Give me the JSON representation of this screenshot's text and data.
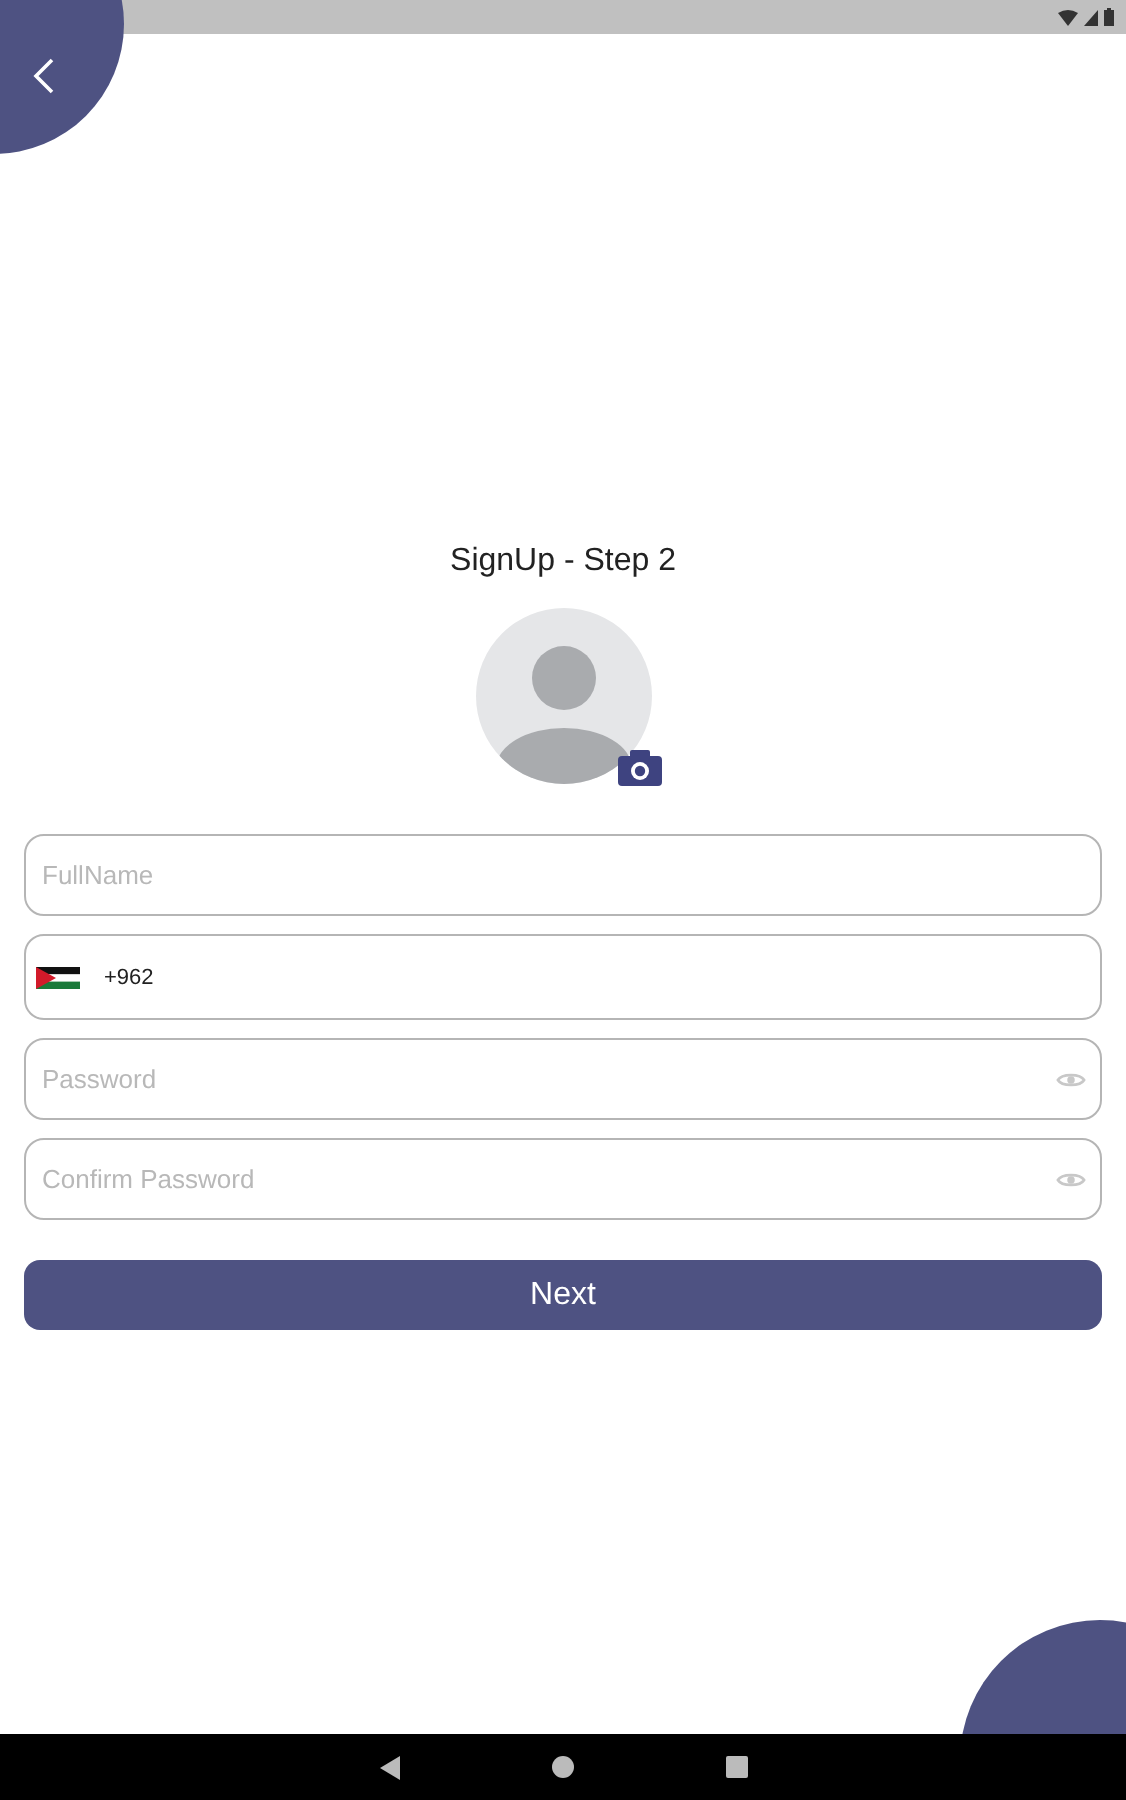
{
  "header": {
    "title": "SignUp - Step 2"
  },
  "fields": [
    {
      "kind": "text",
      "placeholder": "FullName"
    },
    {
      "kind": "phone",
      "value": "+962"
    },
    {
      "kind": "password",
      "placeholder": "Password"
    },
    {
      "kind": "password",
      "placeholder": "Confirm Password"
    }
  ],
  "primary_button": {
    "label": "Next"
  }
}
